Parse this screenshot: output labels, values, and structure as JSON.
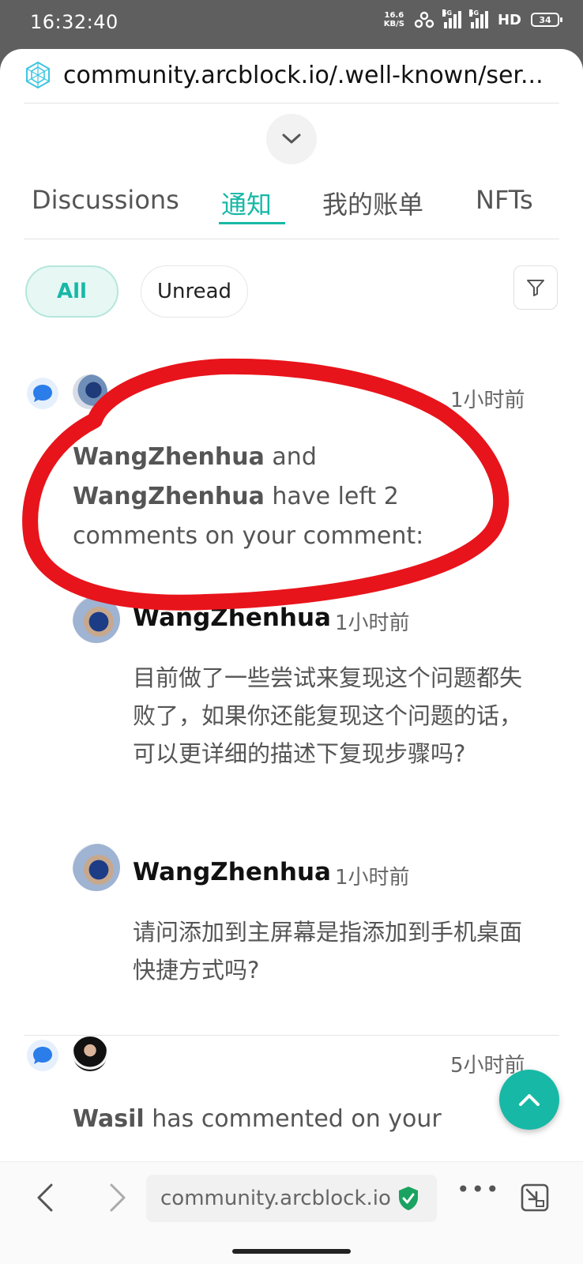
{
  "status_bar": {
    "time": "16:32:40",
    "net_speed_top": "16.6",
    "net_speed_bottom": "KB/S",
    "signal1_label": "5G",
    "signal2_label": "5G",
    "hd_label": "HD",
    "battery": "34"
  },
  "browser": {
    "url_header": "community.arcblock.io/.well-known/ser...",
    "url_bottom": "community.arcblock.io"
  },
  "tabs": [
    {
      "label": "Discussions",
      "active": false
    },
    {
      "label": "通知",
      "active": true
    },
    {
      "label": "我的账单",
      "active": false
    },
    {
      "label": "NFTs",
      "active": false
    }
  ],
  "filters": {
    "all_label": "All",
    "unread_label": "Unread"
  },
  "notifications": [
    {
      "timestamp": "1小时前",
      "actor1": "WangZhenhua",
      "connector": "and",
      "actor2": "WangZhenhua",
      "message": "have left 2 comments on your comment:",
      "comments": [
        {
          "author": "WangZhenhua",
          "time": "1小时前",
          "body": "目前做了一些尝试来复现这个问题都失败了，如果你还能复现这个问题的话，可以更详细的描述下复现步骤吗?"
        },
        {
          "author": "WangZhenhua",
          "time": "1小时前",
          "body": "请问添加到主屏幕是指添加到手机桌面快捷方式吗?"
        }
      ]
    },
    {
      "timestamp": "5小时前",
      "actor1": "Wasil",
      "message": "has commented on your"
    }
  ],
  "colors": {
    "accent": "#17b8a6",
    "annotation_red": "#e8141b",
    "status_bar_bg": "#5f5f5f"
  }
}
